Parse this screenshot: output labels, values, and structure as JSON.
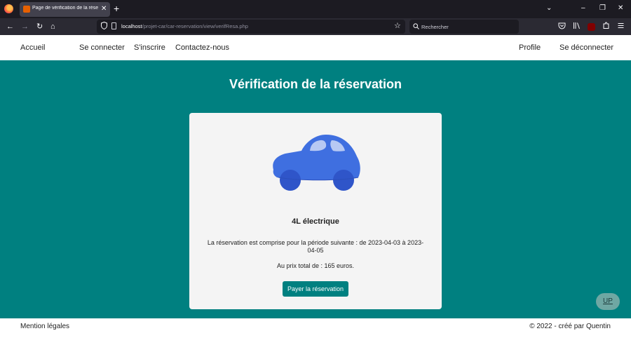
{
  "browser": {
    "tab_title": "Page de vérification de la réservation",
    "tab_close": "✕",
    "new_tab": "+",
    "tabs_list": "⌄",
    "window_minimize": "–",
    "window_restore": "❐",
    "window_close": "✕",
    "url_host": "localhost",
    "url_path": "/projet-car/car-reservation/view/verifResa.php",
    "search_placeholder": "Rechercher",
    "nav_back": "←",
    "nav_forward": "→",
    "nav_reload": "↻",
    "nav_home": "⌂",
    "bookmark_star": "☆",
    "icons": [
      "firefox-logo-icon",
      "back-arrow-icon",
      "forward-arrow-icon",
      "reload-icon",
      "home-icon",
      "shield-icon",
      "page-icon",
      "star-icon",
      "search-icon",
      "pocket-icon",
      "library-icon",
      "ublock-icon",
      "extensions-icon",
      "menu-icon"
    ]
  },
  "header": {
    "home": "Accueil",
    "login": "Se connecter",
    "signup": "S'inscrire",
    "contact": "Contactez-nous",
    "profile": "Profile",
    "logout": "Se déconnecter"
  },
  "main": {
    "title": "Vérification de la réservation",
    "car_name": "4L électrique",
    "period_text": "La réservation est comprise pour la période suivante : de 2023-04-03 à 2023-04-05",
    "price_text": "Au prix total de : 165 euros.",
    "pay_button": "Payer la réservation",
    "up_button": "UP"
  },
  "footer": {
    "legal": "Mention légales",
    "copyright": "© 2022 - créé par Quentin"
  },
  "colors": {
    "teal": "#008080",
    "card_bg": "#f4f4f4",
    "car_body": "#3f6fe0",
    "car_window": "#b7c9f3",
    "car_wheel": "#2f55c9",
    "up_button": "#6fa7a3"
  }
}
